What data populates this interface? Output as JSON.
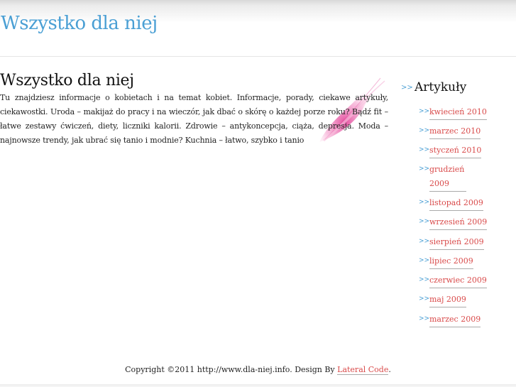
{
  "header": {
    "site_title": "Wszystko dla niej"
  },
  "main": {
    "heading": "Wszystko dla niej",
    "intro": "Tu znajdziesz informacje o kobietach i na temat kobiet. Informacje, porady, ciekawe artykuły, ciekawostki. Uroda – makijaż do pracy i na wieczór, jak dbać o skórę o każdej porze roku? Bądź fit – łatwe zestawy ćwiczeń, diety, liczniki kalorii. Zdrowie – antykoncepcja, ciąża, depresja. Moda – najnowsze trendy, jak ubrać się tanio i modnie? Kuchnia – łatwo, szybko i tanio"
  },
  "sidebar": {
    "arrow": ">>",
    "title": "Artykuły",
    "items": [
      {
        "label": "kwiecień 2010"
      },
      {
        "label": "marzec 2010"
      },
      {
        "label": "styczeń 2010"
      },
      {
        "label": "grudzień 2009"
      },
      {
        "label": "listopad 2009"
      },
      {
        "label": "wrzesień 2009"
      },
      {
        "label": "sierpień 2009"
      },
      {
        "label": "lipiec 2009"
      },
      {
        "label": "czerwiec 2009"
      },
      {
        "label": "maj 2009"
      },
      {
        "label": "marzec 2009"
      }
    ]
  },
  "footer": {
    "copyright": "Copyright ©2011 http://www.dla-niej.info. Design By ",
    "link": "Lateral Code",
    "end": "."
  },
  "colors": {
    "title_blue": "#4a9fd4",
    "link_red": "#d94a4a",
    "feather_pink": "#e0338f"
  }
}
